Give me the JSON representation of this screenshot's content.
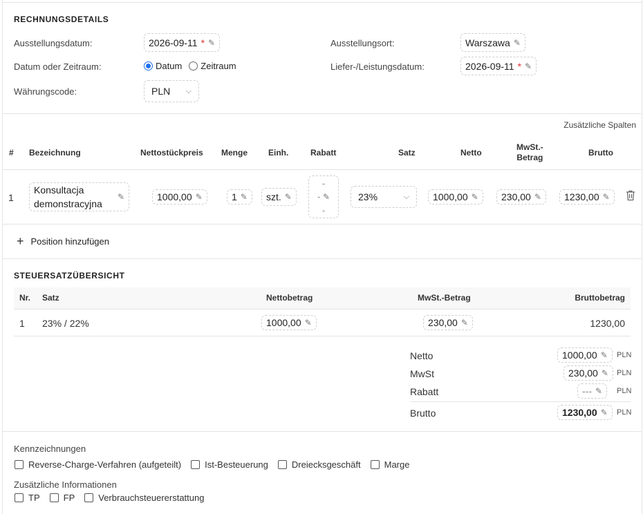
{
  "details": {
    "title": "RECHNUNGSDETAILS",
    "issue_date_label": "Ausstellungsdatum:",
    "issue_date_value": "2026-09-11",
    "required_mark": "*",
    "issue_place_label": "Ausstellungsort:",
    "issue_place_value": "Warszawa",
    "date_mode_label": "Datum oder Zeitraum:",
    "radio_date": "Datum",
    "radio_period": "Zeitraum",
    "selected_mode": "Datum",
    "delivery_date_label": "Liefer-/Leistungsdatum:",
    "delivery_date_value": "2026-09-11",
    "currency_label": "Währungscode:",
    "currency_value": "PLN"
  },
  "items": {
    "extra_columns": "Zusätzliche Spalten",
    "columns": {
      "idx": "#",
      "name": "Bezeichnung",
      "net_unit": "Nettostückpreis",
      "qty": "Menge",
      "unit": "Einh.",
      "discount": "Rabatt",
      "rate": "Satz",
      "net": "Netto",
      "vat_line1": "MwSt.-",
      "vat_line2": "Betrag",
      "gross": "Brutto"
    },
    "rows": [
      {
        "idx": "1",
        "name_line1": "Konsultacja",
        "name_line2": "demonstracyjna",
        "net_unit": "1000,00",
        "qty": "1",
        "unit": "szt.",
        "discount_l1": "-",
        "discount_l2": "-",
        "discount_l3": "-",
        "rate": "23%",
        "net": "1000,00",
        "vat": "230,00",
        "gross": "1230,00"
      }
    ],
    "add_position": "Position hinzufügen"
  },
  "tax_summary": {
    "title": "STEUERSATZÜBERSICHT",
    "columns": {
      "nr": "Nr.",
      "rate": "Satz",
      "net": "Nettobetrag",
      "vat": "MwSt.-Betrag",
      "gross": "Bruttobetrag"
    },
    "rows": [
      {
        "nr": "1",
        "rate": "23% / 22%",
        "net": "1000,00",
        "vat": "230,00",
        "gross": "1230,00"
      }
    ]
  },
  "totals": {
    "net_label": "Netto",
    "net_value": "1000,00",
    "vat_label": "MwSt",
    "vat_value": "230,00",
    "discount_label": "Rabatt",
    "discount_value": "---",
    "gross_label": "Brutto",
    "gross_value": "1230,00",
    "currency": "PLN"
  },
  "marks": {
    "title": "Kennzeichnungen",
    "options": [
      "Reverse-Charge-Verfahren (aufgeteilt)",
      "Ist-Besteuerung",
      "Dreiecksgeschäft",
      "Marge"
    ]
  },
  "additional": {
    "title": "Zusätzliche Informationen",
    "options": [
      "TP",
      "FP",
      "Verbrauchsteuererstattung"
    ]
  },
  "icons": {
    "pencil": "pencil-icon",
    "chevron": "chevron-down-icon",
    "trash": "trash-icon",
    "plus": "plus-icon"
  },
  "colors": {
    "accent": "#1f6feb",
    "required": "#e03131",
    "border": "#e4e4e4"
  }
}
